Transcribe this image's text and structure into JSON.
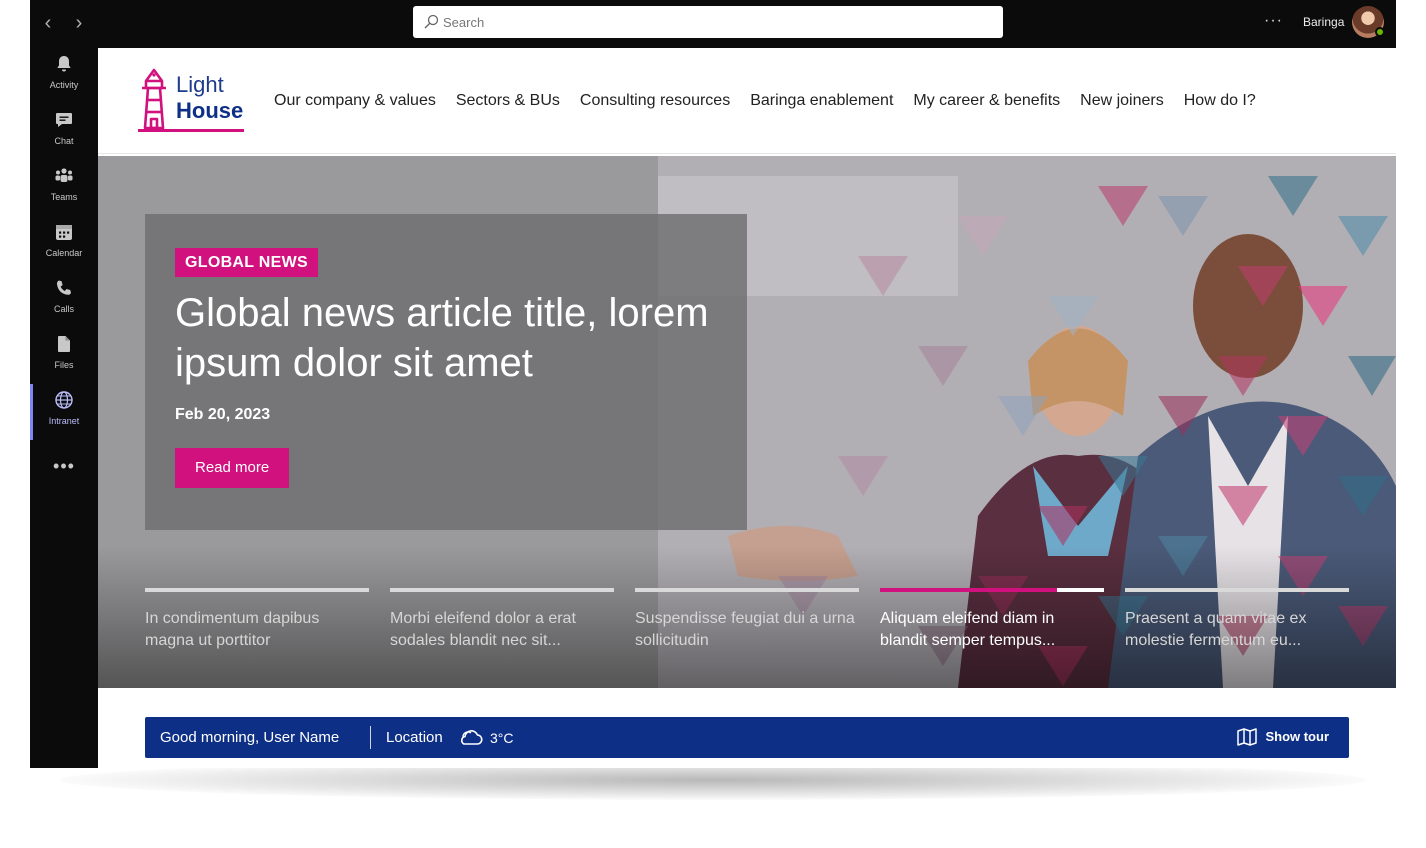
{
  "topbar": {
    "search_placeholder": "Search",
    "more": "···",
    "user_name": "Baringa"
  },
  "rail": {
    "items": [
      {
        "label": "Activity",
        "icon": "bell-icon"
      },
      {
        "label": "Chat",
        "icon": "chat-icon"
      },
      {
        "label": "Teams",
        "icon": "teams-icon"
      },
      {
        "label": "Calendar",
        "icon": "calendar-icon"
      },
      {
        "label": "Calls",
        "icon": "phone-icon"
      },
      {
        "label": "Files",
        "icon": "file-icon"
      },
      {
        "label": "Intranet",
        "icon": "globe-icon"
      }
    ],
    "more": "•••",
    "active": "Intranet"
  },
  "site": {
    "logo_line1": "Light",
    "logo_line2": "House",
    "menu": [
      "Our company & values",
      "Sectors & BUs",
      "Consulting resources",
      "Baringa enablement",
      "My career & benefits",
      "New joiners",
      "How do I?"
    ]
  },
  "hero": {
    "badge": "GLOBAL NEWS",
    "title": "Global news article title, lorem ipsum dolor sit amet",
    "date": "Feb 20, 2023",
    "cta": "Read more",
    "slides": [
      {
        "text": "In condimentum dapibus magna ut porttitor",
        "progress": 0
      },
      {
        "text": "Morbi eleifend dolor a erat sodales blandit nec sit...",
        "progress": 0
      },
      {
        "text": "Suspendisse feugiat dui a urna sollicitudin",
        "progress": 0
      },
      {
        "text": "Aliquam eleifend diam in blandit semper tempus...",
        "progress": 0.79
      },
      {
        "text": "Praesent a quam vitae ex molestie fermentum eu...",
        "progress": 0
      }
    ],
    "active_slide": 3
  },
  "greeting": {
    "text": "Good morning, User Name",
    "location": "Location",
    "temperature": "3°C",
    "tour": "Show tour"
  },
  "colors": {
    "accent": "#d1117d",
    "brand_blue": "#0e2f86",
    "teams_dark": "#0b0b0b",
    "rail_active": "#7f85f5"
  }
}
